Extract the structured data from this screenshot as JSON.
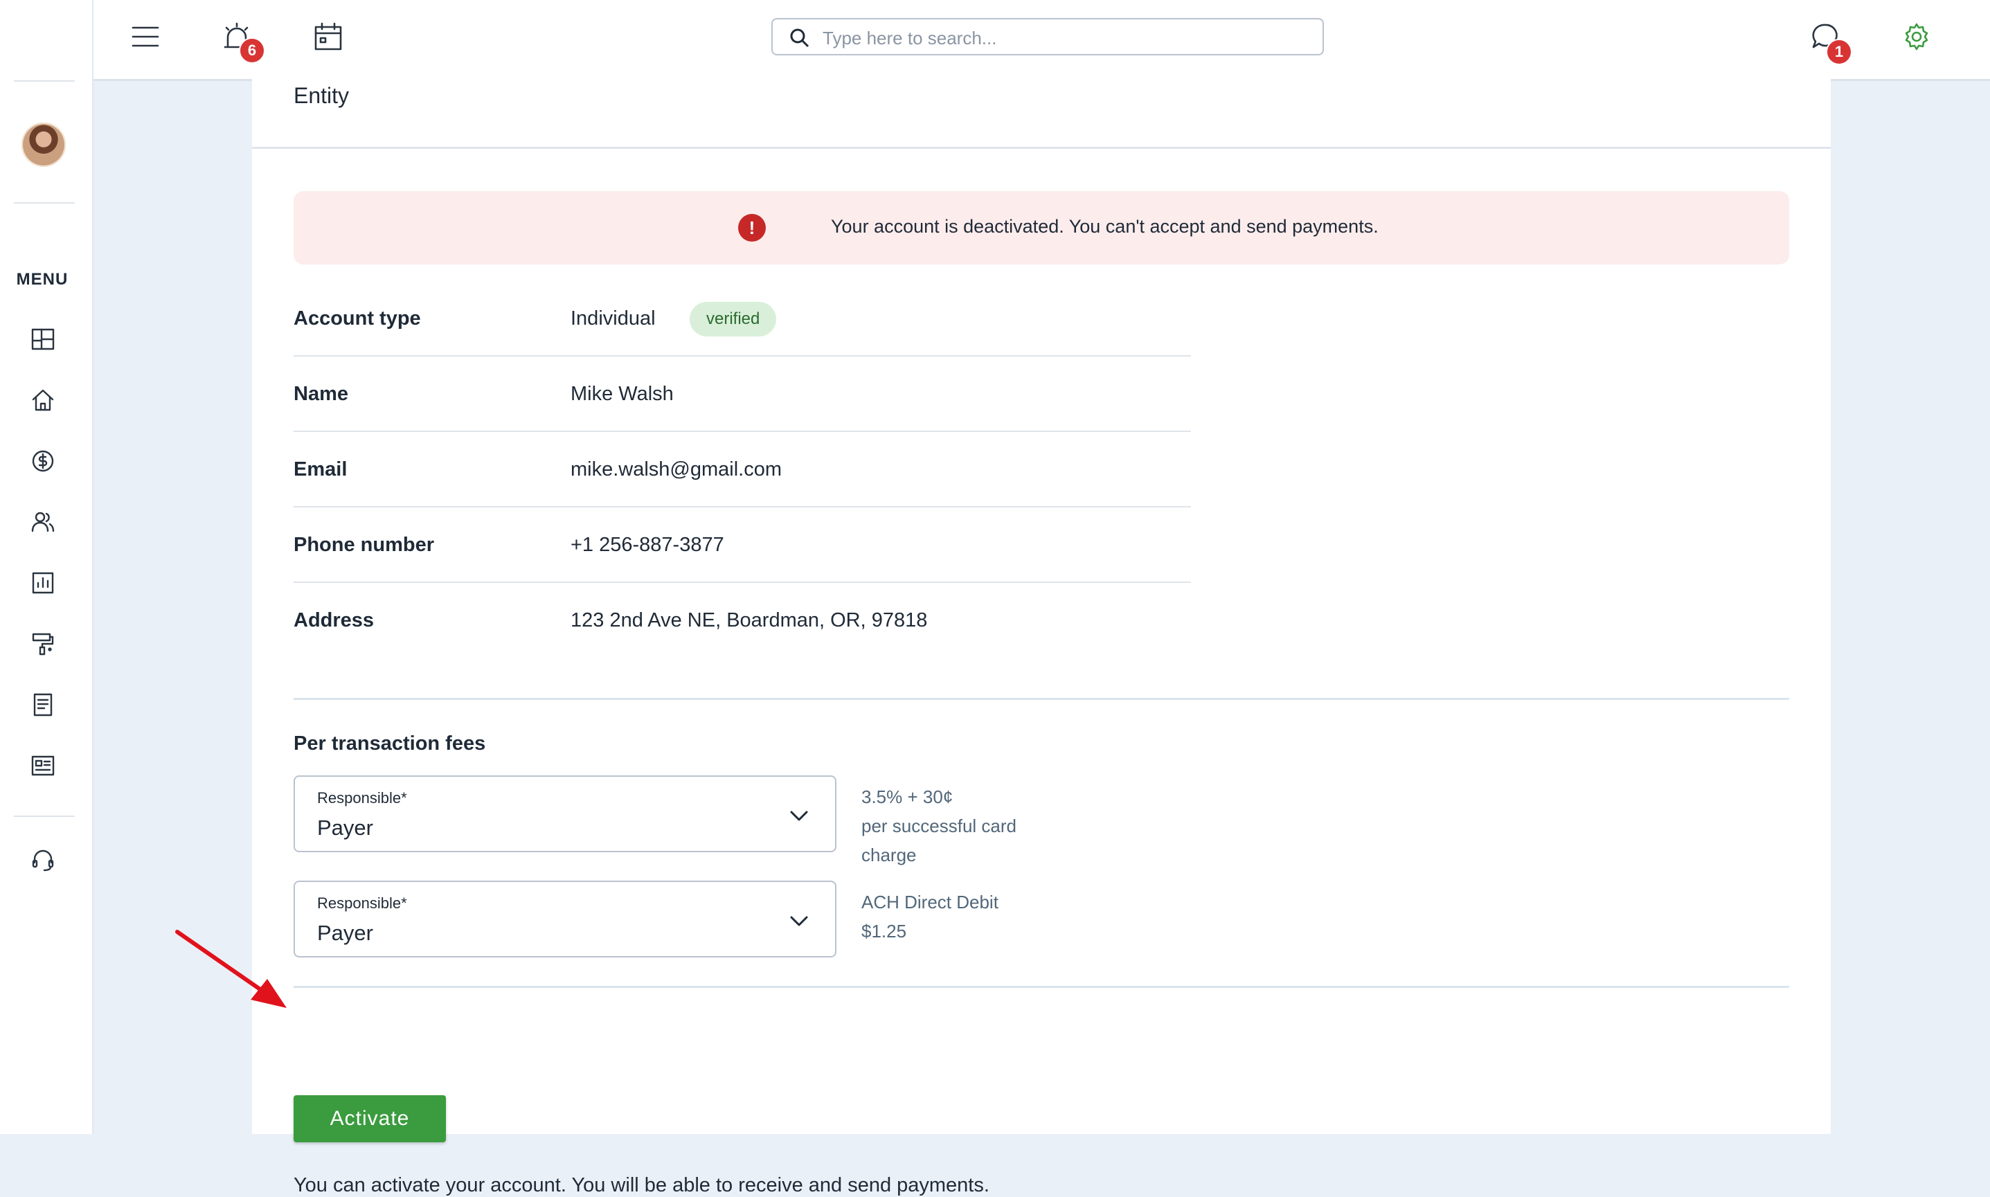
{
  "topbar": {
    "search_placeholder": "Type here to search...",
    "notifications_count": "6",
    "messages_count": "1"
  },
  "sidebar": {
    "menu_label": "MENU",
    "items": [
      "dashboard-icon",
      "home-icon",
      "dollar-icon",
      "users-icon",
      "reports-icon",
      "paint-roller-icon",
      "document-icon",
      "news-icon",
      "support-headset-icon"
    ]
  },
  "entity": {
    "title": "Entity",
    "alert_icon": "!",
    "alert_text": "Your account is deactivated. You can't accept and send payments.",
    "account_type_label": "Account type",
    "account_type_value": "Individual",
    "verified_badge": "verified",
    "name_label": "Name",
    "name_value": "Mike Walsh",
    "email_label": "Email",
    "email_value": "mike.walsh@gmail.com",
    "phone_label": "Phone number",
    "phone_value": "+1 256-887-3877",
    "address_label": "Address",
    "address_value": "123 2nd Ave NE, Boardman, OR, 97818"
  },
  "fees": {
    "title": "Per transaction fees",
    "card": {
      "select_label": "Responsible*",
      "select_value": "Payer",
      "note_line1": "3.5% + 30¢",
      "note_line2": "per successful card",
      "note_line3": "charge"
    },
    "ach": {
      "select_label": "Responsible*",
      "select_value": "Payer",
      "note_line1": "ACH Direct Debit",
      "note_line2": "$1.25"
    }
  },
  "actions": {
    "activate_label": "Activate",
    "activate_note": "You can activate your account. You will be able to receive and send payments."
  },
  "colors": {
    "accent_green": "#3a9c3e",
    "alert_bg": "#fdecec",
    "alert_icon": "#c62828",
    "badge_red": "#d93434",
    "settings_green": "#3a9c3e",
    "annotation_arrow": "#e0121c"
  }
}
